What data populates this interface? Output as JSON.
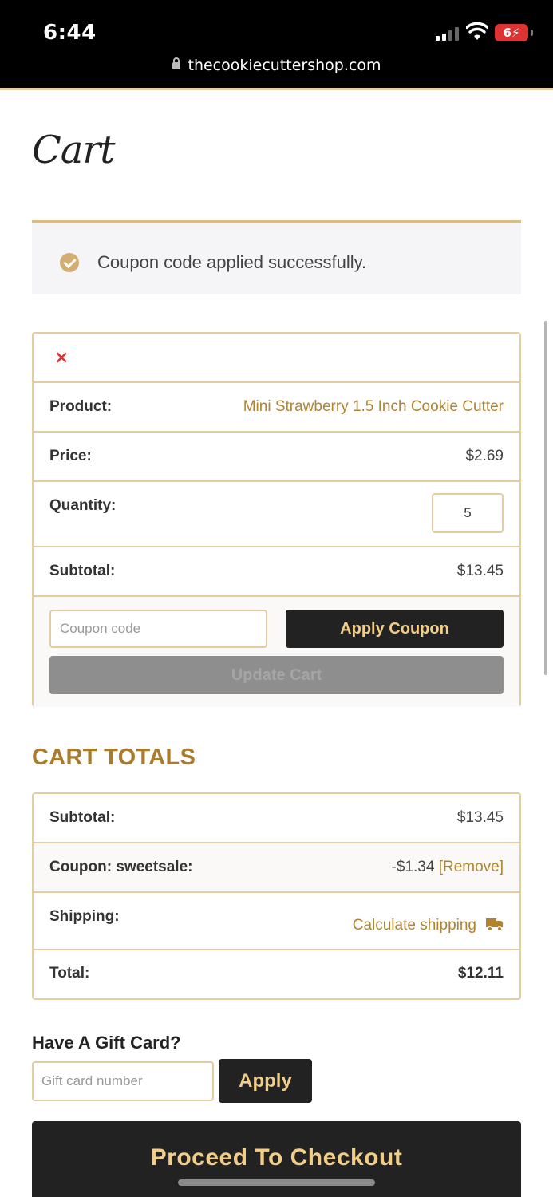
{
  "status_bar": {
    "time": "6:44",
    "battery": "6",
    "url": "thecookiecuttershop.com"
  },
  "page": {
    "title": "Cart"
  },
  "notice": {
    "message": "Coupon code applied successfully."
  },
  "cart_item": {
    "remove_icon": "×",
    "product_label": "Product:",
    "product_name": "Mini Strawberry 1.5 Inch Cookie Cutter",
    "price_label": "Price:",
    "price": "$2.69",
    "quantity_label": "Quantity:",
    "quantity": "5",
    "subtotal_label": "Subtotal:",
    "subtotal": "$13.45"
  },
  "coupon": {
    "placeholder": "Coupon code",
    "apply_label": "Apply Coupon",
    "update_label": "Update Cart"
  },
  "totals": {
    "heading": "CART TOTALS",
    "subtotal_label": "Subtotal:",
    "subtotal": "$13.45",
    "coupon_label": "Coupon: sweetsale:",
    "coupon_amount": "-$1.34",
    "coupon_remove": "[Remove]",
    "shipping_label": "Shipping:",
    "shipping_link": "Calculate shipping",
    "total_label": "Total:",
    "total": "$12.11"
  },
  "gift_card": {
    "heading": "Have A Gift Card?",
    "placeholder": "Gift card number",
    "apply_label": "Apply"
  },
  "checkout": {
    "label": "Proceed To Checkout"
  },
  "colors": {
    "accent_gold": "#b08330",
    "border_gold": "#e5cda0",
    "button_dark": "#222222",
    "button_text": "#f2cd87"
  },
  "icons": {
    "success": "check-circle-icon",
    "shipping": "truck-icon",
    "remove": "close-icon"
  }
}
